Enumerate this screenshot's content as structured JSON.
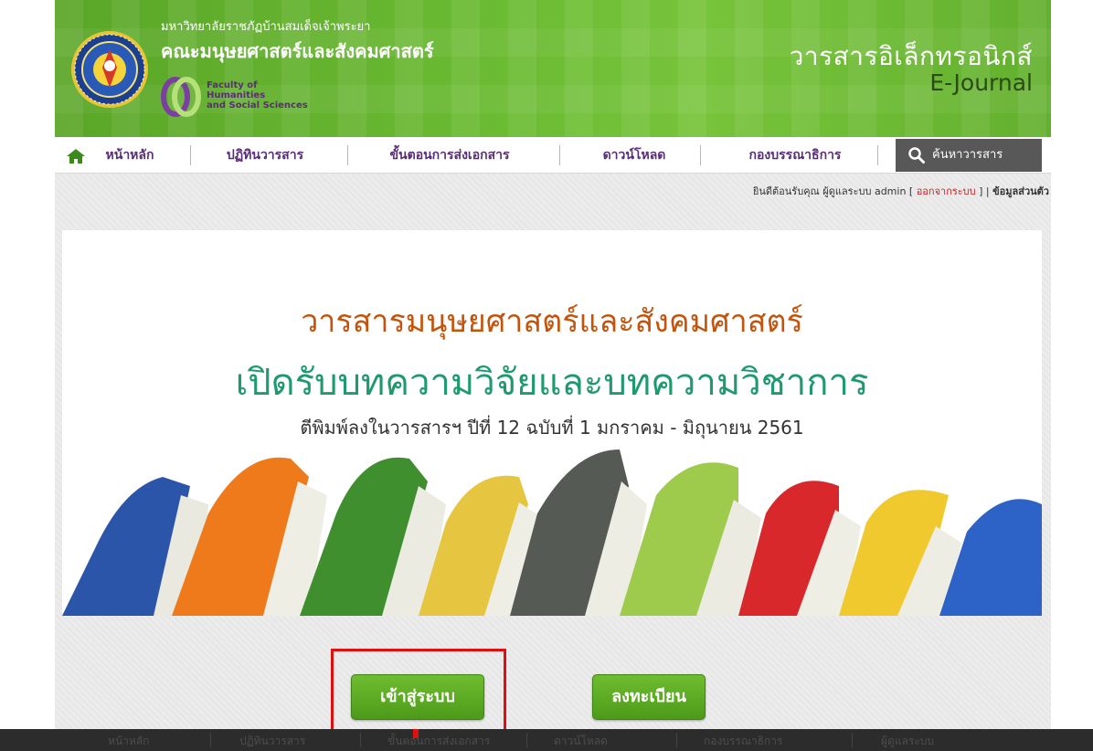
{
  "header": {
    "university_name": "มหาวิทยาลัยราชภัฏบ้านสมเด็จเจ้าพระยา",
    "faculty_name_th": "คณะมนุษยศาสตร์และสังคมศาสตร์",
    "faculty_name_en_1": "Faculty of",
    "faculty_name_en_2": "Humanities",
    "faculty_name_en_3": "and Social Sciences",
    "journal_title_th": "วารสารอิเล็กทรอนิกส์",
    "journal_title_en": "E-Journal"
  },
  "nav": {
    "home": "หน้าหลัก",
    "calendar": "ปฏิทินวารสาร",
    "submission": "ขั้นตอนการส่งเอกสาร",
    "download": "ดาวน์โหลด",
    "editorial": "กองบรรณาธิการ",
    "search": "ค้นหาวารสาร"
  },
  "welcome": {
    "greeting": "ยินดีต้อนรับคุณ ผู้ดูแลระบบ admin [ ",
    "logout": "ออกจากระบบ",
    "tail": " ] | ",
    "profile": "ข้อมูลส่วนตัว"
  },
  "banner": {
    "line1": "วารสารมนุษยศาสตร์และสังคมศาสตร์",
    "line2": "เปิดรับบทความวิจัยและบทความวิชาการ",
    "line3": "ตีพิมพ์ลงในวารสารฯ ปีที่ 12 ฉบับที่ 1 มกราคม - มิถุนายน 2561"
  },
  "buttons": {
    "login": "เข้าสู่ระบบ",
    "register": "ลงทะเบียน"
  },
  "footer": {
    "items": [
      "หน้าหลัก",
      "ปฏิทินวารสาร",
      "ขั้นตอนการส่งเอกสาร",
      "ดาวน์โหลด",
      "กองบรรณาธิการ",
      "ผู้ดูแลระบบ"
    ]
  },
  "colors": {
    "header_green": "#6bbb33",
    "nav_text": "#5a2d78",
    "banner_line1": "#c4540c",
    "banner_line2": "#1f9a6e",
    "button_green": "#5aa822",
    "highlight_red": "#e01010"
  },
  "icons": {
    "home": "home-icon",
    "search": "search-icon",
    "seal": "university-seal-icon",
    "faculty_logo": "faculty-logo-icon"
  }
}
